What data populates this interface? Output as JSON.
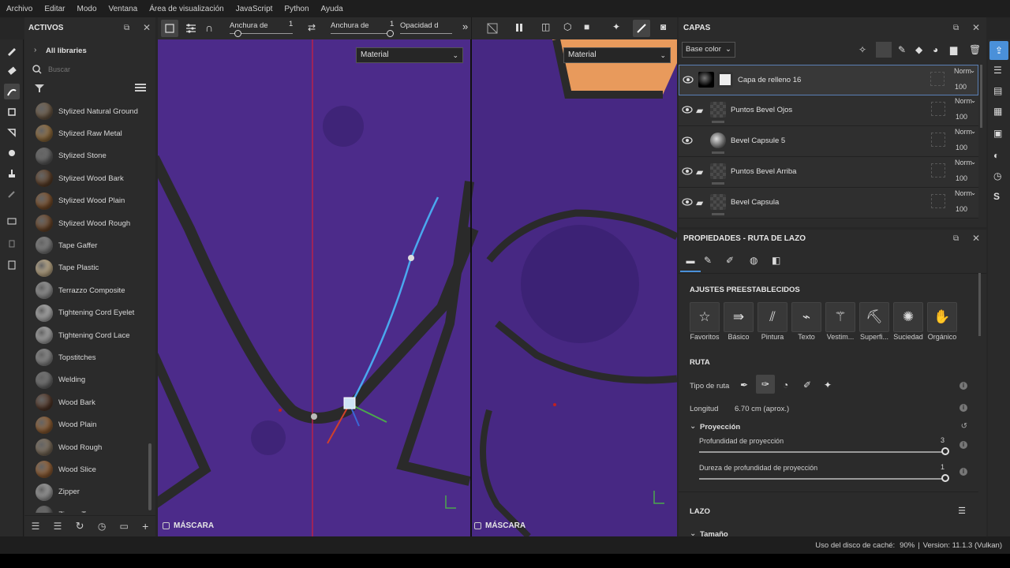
{
  "menu": [
    "Archivo",
    "Editar",
    "Modo",
    "Ventana",
    "Área de visualización",
    "JavaScript",
    "Python",
    "Ayuda"
  ],
  "assets": {
    "title": "ACTIVOS",
    "library": "All libraries",
    "search_placeholder": "Buscar",
    "items": [
      {
        "label": "Stylized Natural Ground",
        "color": "#7a6650"
      },
      {
        "label": "Stylized Raw Metal",
        "color": "#a27a45"
      },
      {
        "label": "Stylized Stone",
        "color": "#6f6f6f"
      },
      {
        "label": "Stylized Wood Bark",
        "color": "#6b4a30"
      },
      {
        "label": "Stylized Wood Plain",
        "color": "#8a5a32"
      },
      {
        "label": "Stylized Wood Rough",
        "color": "#7a5232"
      },
      {
        "label": "Tape Gaffer",
        "color": "#8d8d8d"
      },
      {
        "label": "Tape Plastic",
        "color": "#d8c29a"
      },
      {
        "label": "Terrazzo Composite",
        "color": "#a8a8a8"
      },
      {
        "label": "Tightening Cord Eyelet",
        "color": "#c6c6c6"
      },
      {
        "label": "Tightening Cord Lace",
        "color": "#bdbdbd"
      },
      {
        "label": "Topstitches",
        "color": "#9a9a9a"
      },
      {
        "label": "Welding",
        "color": "#7c7c7c"
      },
      {
        "label": "Wood Bark",
        "color": "#5e4030"
      },
      {
        "label": "Wood Plain",
        "color": "#a06a3a"
      },
      {
        "label": "Wood Rough",
        "color": "#8a7a66"
      },
      {
        "label": "Wood Slice",
        "color": "#a36b3c"
      },
      {
        "label": "Zipper",
        "color": "#b0b0b0"
      },
      {
        "label": "Zipper Tape",
        "color": "#6a6a6a"
      }
    ]
  },
  "toolbar": {
    "width1_label": "Anchura de",
    "width1_value": "1",
    "width2_label": "Anchura de",
    "width2_value": "1",
    "opacity_label": "Opacidad d"
  },
  "viewport": {
    "left_material": "Material",
    "right_material": "Material",
    "mask_left": "MÁSCARA",
    "mask_right": "MÁSCARA"
  },
  "layers": {
    "title": "CAPAS",
    "blend_mode": "Base color",
    "items": [
      {
        "name": "Capa de relleno 16",
        "blend": "Norm",
        "opacity": "100",
        "selected": true
      },
      {
        "name": "Puntos Bevel Ojos",
        "blend": "Norm",
        "opacity": "100"
      },
      {
        "name": "Bevel Capsule 5",
        "blend": "Norm",
        "opacity": "100"
      },
      {
        "name": "Puntos Bevel Arriba",
        "blend": "Norm",
        "opacity": "100"
      },
      {
        "name": "Bevel Capsula",
        "blend": "Norm",
        "opacity": "100"
      }
    ]
  },
  "properties": {
    "title": "PROPIEDADES - RUTA DE LAZO",
    "presets_title": "AJUSTES PREESTABLECIDOS",
    "presets": [
      "Favoritos",
      "Básico",
      "Pintura",
      "Texto",
      "Vestim...",
      "Superfi...",
      "Suciedad",
      "Orgánico"
    ],
    "ruta_title": "RUTA",
    "tipo_label": "Tipo de ruta",
    "longitud_label": "Longitud",
    "longitud_value": "6.70 cm (aprox.)",
    "proyeccion_title": "Proyección",
    "profundidad_label": "Profundidad de proyección",
    "profundidad_value": "3",
    "profundidad_fraction": 1.0,
    "dureza_label": "Dureza de profundidad de proyección",
    "dureza_value": "1",
    "dureza_fraction": 1.0,
    "lazo_title": "LAZO",
    "tamano_title": "Tamaño"
  },
  "status": {
    "cache_label": "Uso del disco de caché:",
    "cache_value": "90%",
    "version": "Version: 11.1.3 (Vulkan)"
  },
  "colors": {
    "accent": "#4a90d9",
    "viewport_bg": "#4a2a85",
    "highlight": "#f0a060"
  }
}
